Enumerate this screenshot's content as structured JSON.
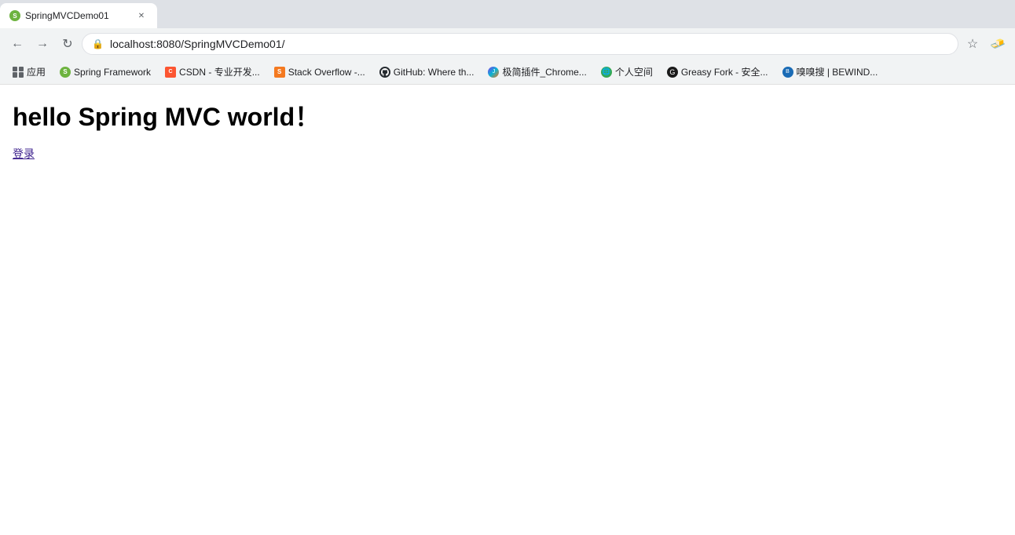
{
  "browser": {
    "tab": {
      "title": "SpringMVCDemo01",
      "url": "localhost:8080/SpringMVCDemo01/"
    },
    "nav": {
      "back_disabled": false,
      "forward_disabled": false,
      "address": "localhost:8080/SpringMVCDemo01/"
    },
    "bookmarks": [
      {
        "id": "apps",
        "label": "应用",
        "type": "apps"
      },
      {
        "id": "spring",
        "label": "Spring Framework",
        "type": "spring"
      },
      {
        "id": "csdn",
        "label": "CSDN - 专业开发...",
        "type": "csdn"
      },
      {
        "id": "stackoverflow",
        "label": "Stack Overflow -...",
        "type": "stackoverflow"
      },
      {
        "id": "github",
        "label": "GitHub: Where th...",
        "type": "github"
      },
      {
        "id": "jijian",
        "label": "极简插件_Chrome...",
        "type": "jijian"
      },
      {
        "id": "personal",
        "label": "个人空间",
        "type": "personal"
      },
      {
        "id": "greasy",
        "label": "Greasy Fork - 安全...",
        "type": "greasy"
      },
      {
        "id": "bewind",
        "label": "嗅嗅搜 | BEWIND...",
        "type": "bewind"
      }
    ]
  },
  "page": {
    "heading": "hello Spring MVC world！",
    "link_text": "登录",
    "link_href": "#"
  }
}
